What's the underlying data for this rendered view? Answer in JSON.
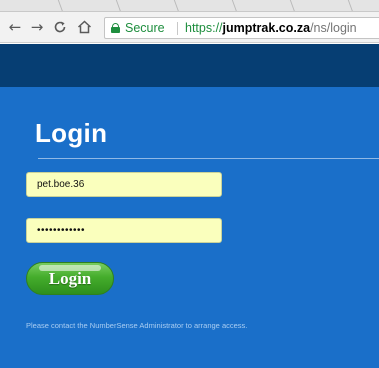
{
  "browser": {
    "url": {
      "scheme": "https://",
      "host": "jumptrak.co.za",
      "path": "/ns/login"
    },
    "security_label": "Secure",
    "nav_icons": [
      "back-arrow-icon",
      "forward-arrow-icon",
      "reload-icon",
      "home-icon"
    ]
  },
  "login": {
    "title": "Login",
    "username_value": "pet.boe.36",
    "password_masked": "••••••••••••",
    "submit_label": "Login",
    "note": "Please contact the NumberSense Administrator to arrange access."
  },
  "colors": {
    "header_bar": "#063e73",
    "page_background": "#1a6fc9",
    "field_autofill": "#faffbd",
    "button_green": "#45ad2c",
    "secure_green": "#1e8e3e"
  }
}
